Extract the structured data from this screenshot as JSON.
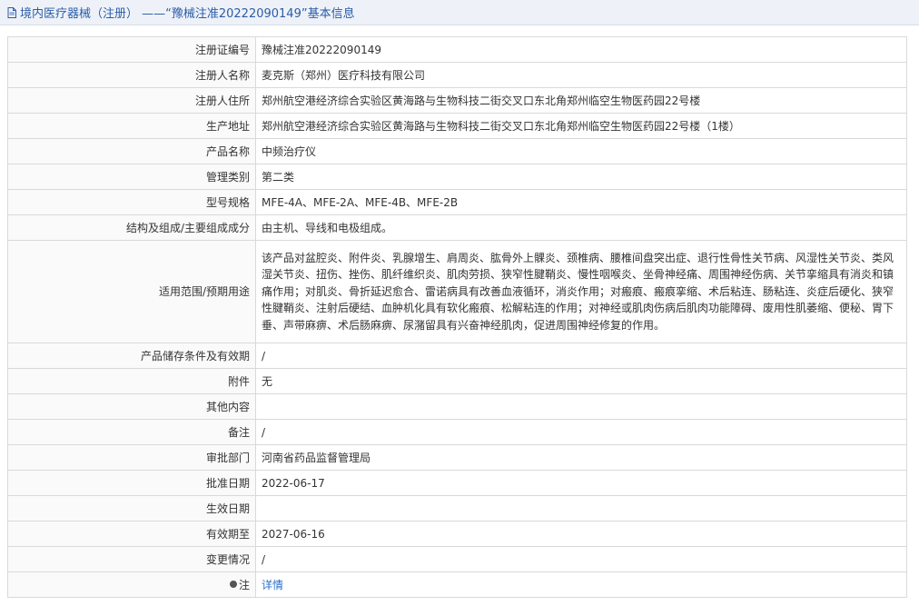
{
  "header": {
    "icon": "document-icon",
    "title": "境内医疗器械（注册） ——“豫械注准20222090149”基本信息"
  },
  "rows": [
    {
      "label": "注册证编号",
      "value": "豫械注准20222090149"
    },
    {
      "label": "注册人名称",
      "value": "麦克斯（郑州）医疗科技有限公司"
    },
    {
      "label": "注册人住所",
      "value": "郑州航空港经济综合实验区黄海路与生物科技二街交叉口东北角郑州临空生物医药园22号楼"
    },
    {
      "label": "生产地址",
      "value": "郑州航空港经济综合实验区黄海路与生物科技二街交叉口东北角郑州临空生物医药园22号楼（1楼）"
    },
    {
      "label": "产品名称",
      "value": "中频治疗仪"
    },
    {
      "label": "管理类别",
      "value": "第二类"
    },
    {
      "label": "型号规格",
      "value": "MFE-4A、MFE-2A、MFE-4B、MFE-2B"
    },
    {
      "label": "结构及组成/主要组成成分",
      "value": "由主机、导线和电极组成。"
    },
    {
      "label": "适用范围/预期用途",
      "value": "该产品对盆腔炎、附件炎、乳腺增生、肩周炎、肱骨外上髁炎、颈椎病、腰椎间盘突出症、退行性骨性关节病、风湿性关节炎、类风湿关节炎、扭伤、挫伤、肌纤维织炎、肌肉劳损、狭窄性腱鞘炎、慢性咽喉炎、坐骨神经痛、周围神经伤病、关节挛缩具有消炎和镇痛作用；对肌炎、骨折延迟愈合、雷诺病具有改善血液循环，消炎作用；对瘢痕、瘢痕挛缩、术后粘连、肠粘连、炎症后硬化、狭窄性腱鞘炎、注射后硬结、血肿机化具有软化瘢痕、松解粘连的作用；对神经或肌肉伤病后肌肉功能障碍、废用性肌萎缩、便秘、胃下垂、声带麻痹、术后肠麻痹、尿潴留具有兴奋神经肌肉，促进周围神经修复的作用。"
    },
    {
      "label": "产品储存条件及有效期",
      "value": "/"
    },
    {
      "label": "附件",
      "value": "无"
    },
    {
      "label": "其他内容",
      "value": ""
    },
    {
      "label": "备注",
      "value": "/"
    },
    {
      "label": "审批部门",
      "value": "河南省药品监督管理局"
    },
    {
      "label": "批准日期",
      "value": "2022-06-17"
    },
    {
      "label": "生效日期",
      "value": ""
    },
    {
      "label": "有效期至",
      "value": "2027-06-16"
    },
    {
      "label": "变更情况",
      "value": "/"
    }
  ],
  "note_row": {
    "label": "注",
    "icon": "pin-icon",
    "link_text": "详情"
  },
  "colors": {
    "title": "#2a5ca8",
    "link": "#2a6fc9",
    "border": "#d9d9d9"
  }
}
